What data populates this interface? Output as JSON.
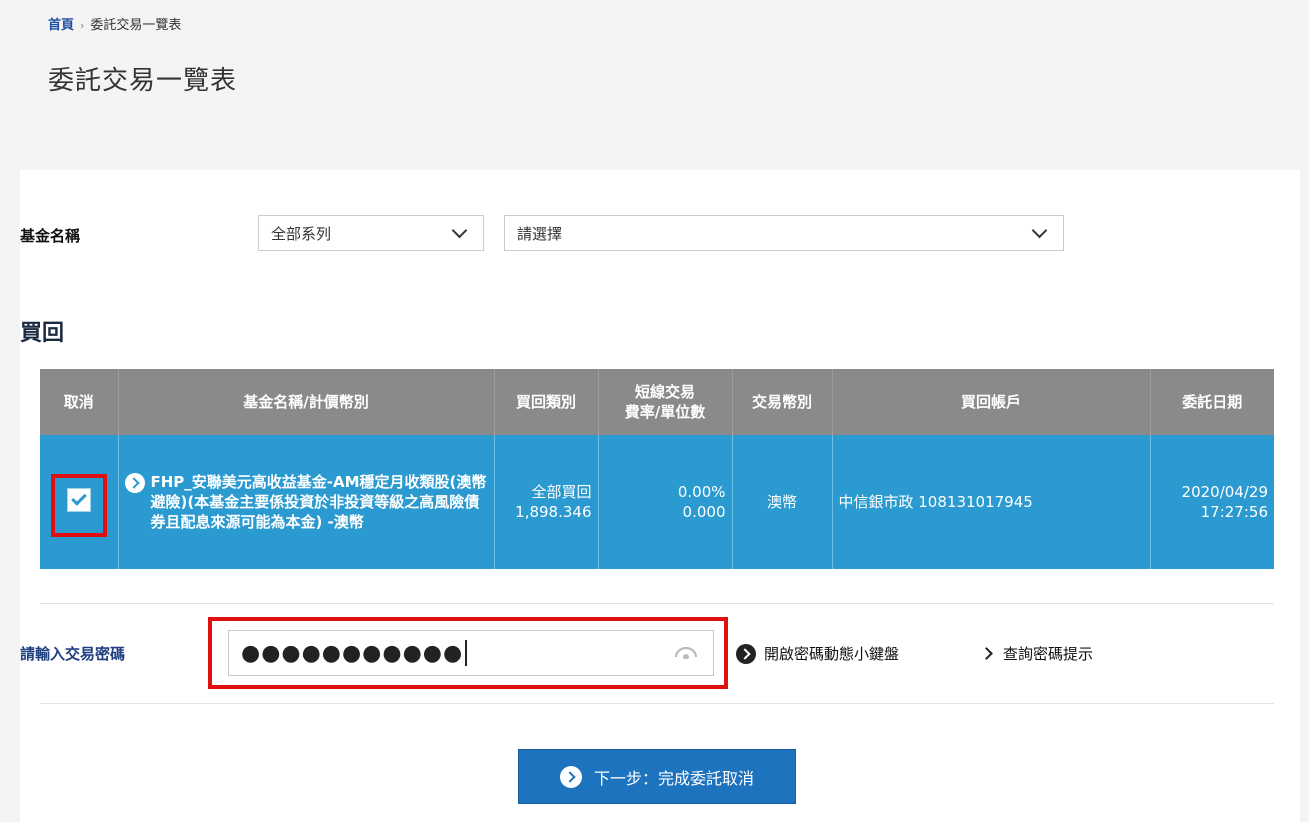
{
  "breadcrumb": {
    "home": "首頁",
    "current": "委託交易一覽表"
  },
  "page_title": "委託交易一覽表",
  "filter": {
    "label": "基金名稱",
    "series_value": "全部系列",
    "fund_value": "請選擇"
  },
  "section_title": "買回",
  "table": {
    "headers": {
      "cancel": "取消",
      "fund": "基金名稱/計價幣別",
      "type": "買回類別",
      "fee_line1": "短線交易",
      "fee_line2": "費率/單位數",
      "currency": "交易幣別",
      "account": "買回帳戶",
      "date": "委託日期"
    },
    "rows": [
      {
        "checked": true,
        "fund_name": "FHP_安聯美元高收益基金-AM穩定月收類股(澳幣避險)(本基金主要係投資於非投資等級之高風險債券且配息來源可能為本金) -澳幣",
        "type_line1": "全部買回",
        "type_line2": "1,898.346",
        "fee_line1": "0.00%",
        "fee_line2": "0.000",
        "currency": "澳幣",
        "account": "中信銀市政 108131017945",
        "date_line1": "2020/04/29",
        "date_line2": "17:27:56"
      }
    ]
  },
  "password": {
    "label": "請輸入交易密碼",
    "masked_value": "●●●●●●●●●●●",
    "icon": "eye-icon"
  },
  "links": {
    "dynamic_keyboard": "開啟密碼動態小鍵盤",
    "password_hint": "查詢密碼提示"
  },
  "next_button": "下一步：完成委託取消",
  "colors": {
    "table_header": "#8a8a8a",
    "row_selected": "#2a9ad1",
    "primary_button": "#1e73be",
    "highlight": "#e01010"
  }
}
